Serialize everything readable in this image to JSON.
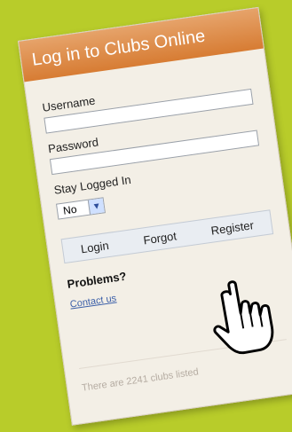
{
  "header": {
    "title": "Log in to Clubs Online"
  },
  "form": {
    "username_label": "Username",
    "password_label": "Password",
    "stay_logged_in_label": "Stay Logged In",
    "stay_logged_in_value": "No",
    "buttons": {
      "login": "Login",
      "forgot": "Forgot",
      "register": "Register"
    }
  },
  "help": {
    "problems": "Problems?",
    "contact": "Contact us"
  },
  "footer": {
    "text": "There are 2241 clubs listed"
  },
  "colors": {
    "background": "#b8cc2a",
    "header": "#d77c33",
    "link": "#3b5fa8"
  },
  "icons": {
    "dropdown": "chevron-down-icon",
    "cursor": "hand-pointer-icon"
  }
}
